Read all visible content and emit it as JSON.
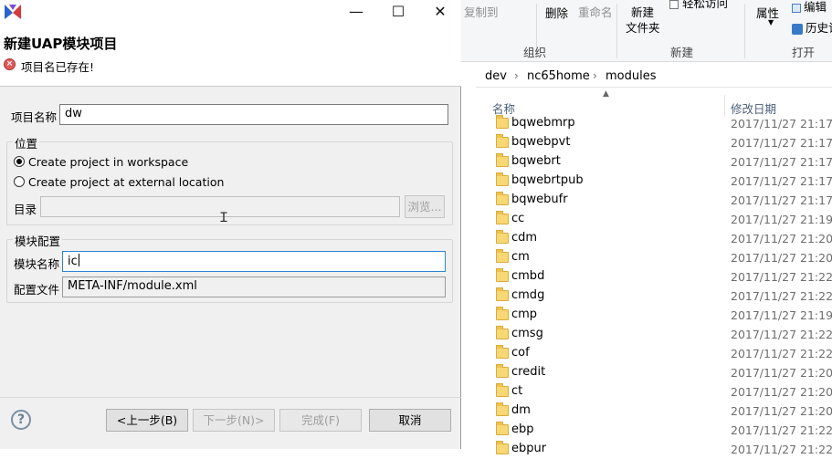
{
  "explorer": {
    "ribbon": {
      "copy_to": "复制到",
      "delete": "删除",
      "rename": "重命名",
      "new_folder_line1": "新建",
      "new_folder_line2": "文件夹",
      "easy_access": "轻松访问",
      "properties": "属性",
      "edit": "编辑",
      "history": "历史记",
      "group_organize": "组织",
      "group_new": "新建",
      "group_open": "打开"
    },
    "breadcrumb": [
      "dev",
      "nc65home",
      "modules"
    ],
    "columns": {
      "name": "名称",
      "modified": "修改日期"
    },
    "files": [
      {
        "name": "bqwebmrp",
        "date": "2017/11/27 21:17"
      },
      {
        "name": "bqwebpvt",
        "date": "2017/11/27 21:17"
      },
      {
        "name": "bqwebrt",
        "date": "2017/11/27 21:17"
      },
      {
        "name": "bqwebrtpub",
        "date": "2017/11/27 21:17"
      },
      {
        "name": "bqwebufr",
        "date": "2017/11/27 21:17"
      },
      {
        "name": "cc",
        "date": "2017/11/27 21:19"
      },
      {
        "name": "cdm",
        "date": "2017/11/27 21:20"
      },
      {
        "name": "cm",
        "date": "2017/11/27 21:20"
      },
      {
        "name": "cmbd",
        "date": "2017/11/27 21:22"
      },
      {
        "name": "cmdg",
        "date": "2017/11/27 21:22"
      },
      {
        "name": "cmp",
        "date": "2017/11/27 21:19"
      },
      {
        "name": "cmsg",
        "date": "2017/11/27 21:22"
      },
      {
        "name": "cof",
        "date": "2017/11/27 21:22"
      },
      {
        "name": "credit",
        "date": "2017/11/27 21:20"
      },
      {
        "name": "ct",
        "date": "2017/11/27 21:20"
      },
      {
        "name": "dm",
        "date": "2017/11/27 21:20"
      },
      {
        "name": "ebp",
        "date": "2017/11/27 21:22"
      },
      {
        "name": "ebpur",
        "date": "2017/11/27 21:22"
      }
    ]
  },
  "dialog": {
    "window_controls": {
      "minimize": "—",
      "maximize": "☐",
      "close": "✕"
    },
    "heading": "新建UAP模块项目",
    "error_message": "项目名已存在!",
    "project_name_label": "项目名称",
    "project_name_value": "dw",
    "location_group": "位置",
    "radio_workspace": "Create project in workspace",
    "radio_external": "Create project at external location",
    "directory_label": "目录",
    "directory_value": "",
    "browse_button": "浏览...",
    "module_group": "模块配置",
    "module_name_label": "模块名称",
    "module_name_value": "ic",
    "config_file_label": "配置文件",
    "config_file_value": "META-INF/module.xml",
    "help_icon_glyph": "?",
    "buttons": {
      "back": "<上一步(B)",
      "next": "下一步(N)>",
      "finish": "完成(F)",
      "cancel": "取消"
    }
  }
}
